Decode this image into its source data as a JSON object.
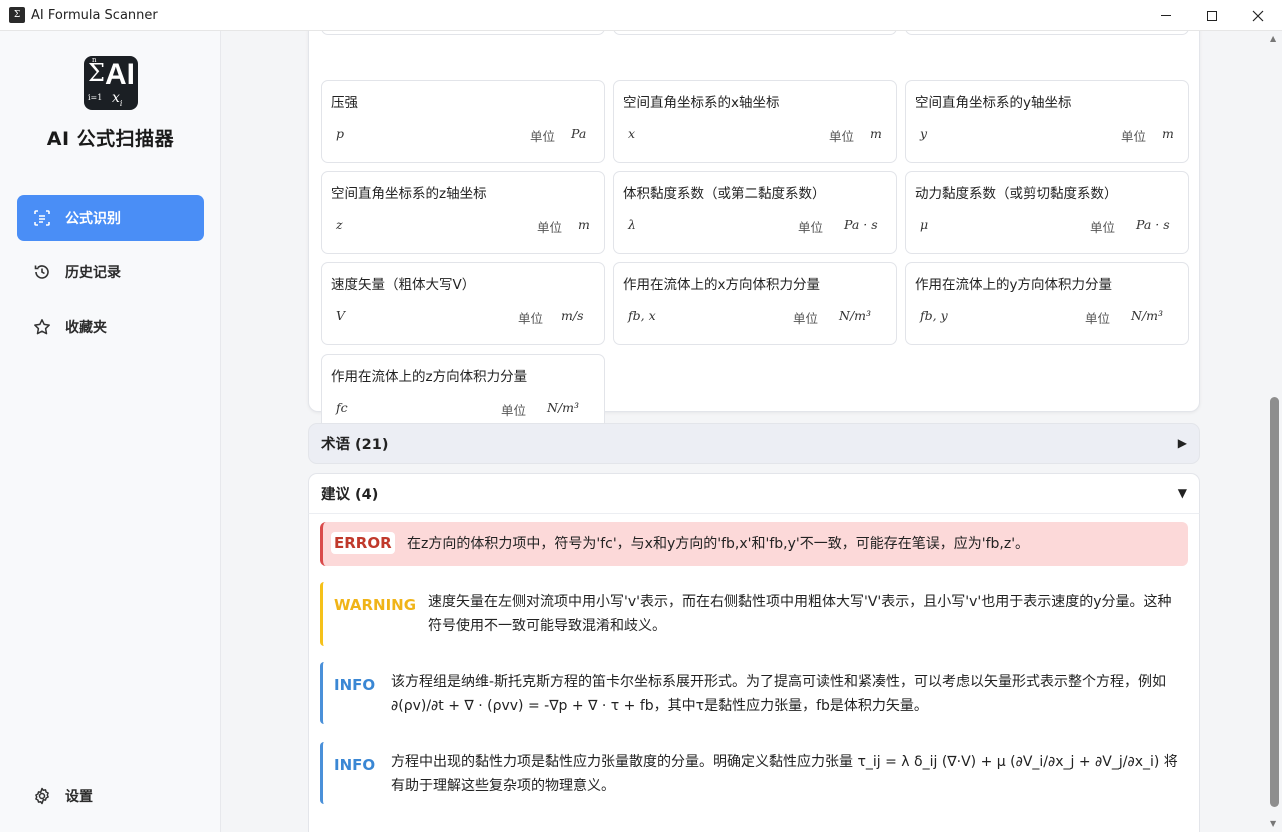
{
  "window": {
    "title": "AI Formula Scanner"
  },
  "sidebar": {
    "app_name": "AI 公式扫描器",
    "nav": [
      {
        "label": "公式识别",
        "icon": "scan-text-icon"
      },
      {
        "label": "历史记录",
        "icon": "history-icon"
      },
      {
        "label": "收藏夹",
        "icon": "star-icon"
      }
    ],
    "settings_label": "设置",
    "settings_icon": "gear-icon"
  },
  "variables": [
    {
      "name": "压强",
      "symbol": "p",
      "unit_label": "单位",
      "unit": "Pa"
    },
    {
      "name": "空间直角坐标系的x轴坐标",
      "symbol": "x",
      "unit_label": "单位",
      "unit": "m"
    },
    {
      "name": "空间直角坐标系的y轴坐标",
      "symbol": "y",
      "unit_label": "单位",
      "unit": "m"
    },
    {
      "name": "空间直角坐标系的z轴坐标",
      "symbol": "z",
      "unit_label": "单位",
      "unit": "m"
    },
    {
      "name": "体积黏度系数（或第二黏度系数）",
      "symbol": "λ",
      "unit_label": "单位",
      "unit": "Pa · s"
    },
    {
      "name": "动力黏度系数（或剪切黏度系数）",
      "symbol": "μ",
      "unit_label": "单位",
      "unit": "Pa · s"
    },
    {
      "name": "速度矢量（粗体大写V）",
      "symbol": "V",
      "unit_label": "单位",
      "unit": "m/s"
    },
    {
      "name": "作用在流体上的x方向体积力分量",
      "symbol": "fb, x",
      "unit_label": "单位",
      "unit": "N/m³"
    },
    {
      "name": "作用在流体上的y方向体积力分量",
      "symbol": "fb, y",
      "unit_label": "单位",
      "unit": "N/m³"
    },
    {
      "name": "作用在流体上的z方向体积力分量",
      "symbol": "fc",
      "unit_label": "单位",
      "unit": "N/m³"
    }
  ],
  "terms_section": {
    "label": "术语 (21)",
    "arrow": "▶"
  },
  "suggestions_section": {
    "label": "建议 (4)",
    "arrow": "▼"
  },
  "suggestions": [
    {
      "level": "ERROR",
      "text": "在z方向的体积力项中，符号为'fc'，与x和y方向的'fb,x'和'fb,y'不一致，可能存在笔误，应为'fb,z'。",
      "color": "#c0392b"
    },
    {
      "level": "WARNING",
      "text": "速度矢量在左侧对流项中用小写'v'表示，而在右侧黏性项中用粗体大写'V'表示，且小写'v'也用于表示速度的y分量。这种符号使用不一致可能导致混淆和歧义。",
      "color": "#f0b418"
    },
    {
      "level": "INFO",
      "text": "该方程组是纳维-斯托克斯方程的笛卡尔坐标系展开形式。为了提高可读性和紧凑性，可以考虑以矢量形式表示整个方程，例如 ∂(ρv)/∂t + ∇ · (ρvv) = -∇p + ∇ · τ + fb，其中τ是黏性应力张量，fb是体积力矢量。",
      "color": "#3a87d4"
    },
    {
      "level": "INFO",
      "text": "方程中出现的黏性力项是黏性应力张量散度的分量。明确定义黏性应力张量 τ_ij = λ δ_ij (∇·V) + μ (∂V_i/∂x_j + ∂V_j/∂x_i) 将有助于理解这些复杂项的物理意义。",
      "color": "#3a87d4"
    }
  ]
}
